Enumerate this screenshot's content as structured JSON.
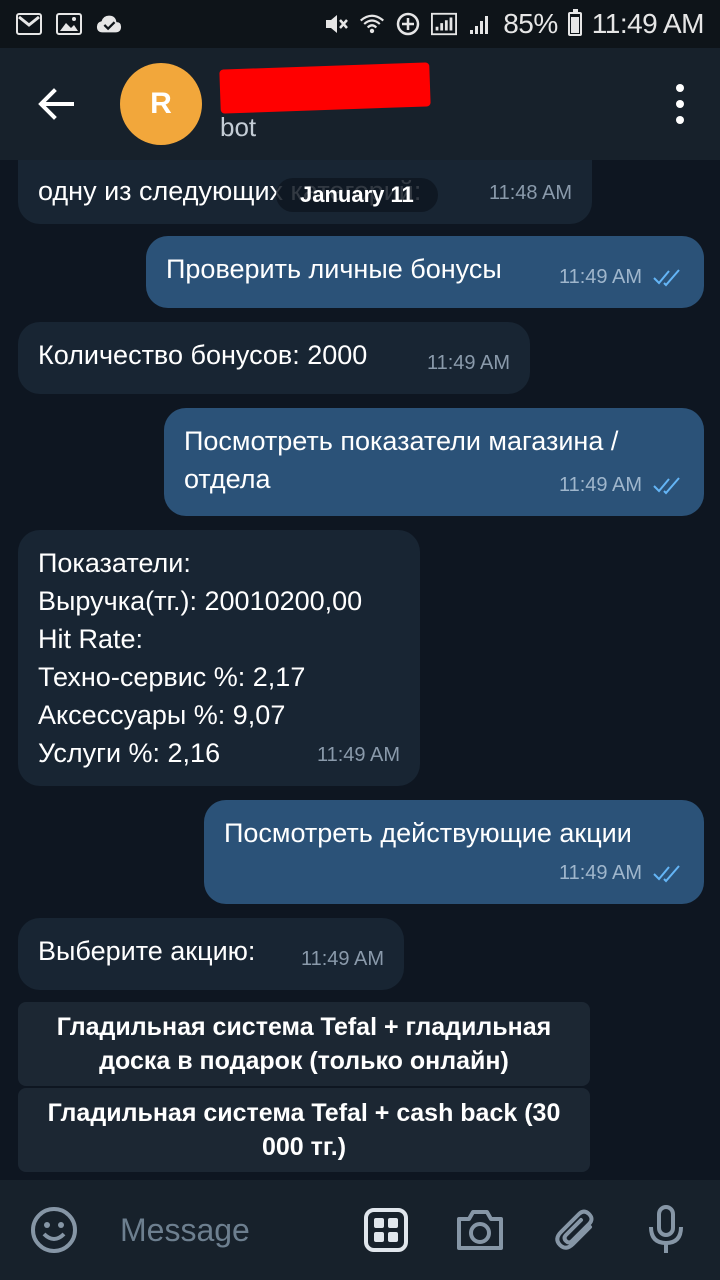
{
  "status_bar": {
    "battery_percent": "85%",
    "time": "11:49 AM",
    "icons": [
      "gmail-icon",
      "gallery-icon",
      "cloud-check-icon",
      "mute-icon",
      "wifi-icon",
      "data-saver-icon",
      "signal-icon",
      "signal-icon-2",
      "battery-icon"
    ]
  },
  "app_bar": {
    "avatar_letter": "R",
    "chat_title": "[redacted]",
    "chat_subtitle": "bot"
  },
  "date_separator": "January 11",
  "messages": [
    {
      "direction": "in",
      "text": "одну из следующих категорий:",
      "time": "11:48 AM"
    },
    {
      "direction": "out",
      "text": "Проверить личные бонусы",
      "time": "11:49 AM",
      "read": true
    },
    {
      "direction": "in",
      "text": "Количество бонусов: 2000",
      "time": "11:49 AM"
    },
    {
      "direction": "out",
      "text": "Посмотреть показатели магазина /\nотдела",
      "time": "11:49 AM",
      "read": true
    },
    {
      "direction": "in",
      "text": "Показатели:\nВыручка(тг.): 20010200,00\nHit Rate:\nТехно-сервис %: 2,17\nАксессуары %: 9,07\nУслуги %: 2,16",
      "time": "11:49 AM"
    },
    {
      "direction": "out",
      "text": "Посмотреть действующие акции",
      "time": "11:49 AM",
      "read": true
    },
    {
      "direction": "in",
      "text": "Выберите акцию:",
      "time": "11:49 AM"
    }
  ],
  "bot_keyboard": [
    "Гладильная система Tefal + гладильная доска в подарок (только онлайн)",
    "Гладильная система Tefal + cash back (30 000 тг.)"
  ],
  "input": {
    "placeholder": "Message"
  },
  "colors": {
    "background": "#0e1621",
    "bar": "#17212b",
    "incoming_bubble": "#182533",
    "outgoing_bubble": "#2b5278",
    "read_check": "#64b5f6",
    "avatar": "#f2a73b"
  }
}
